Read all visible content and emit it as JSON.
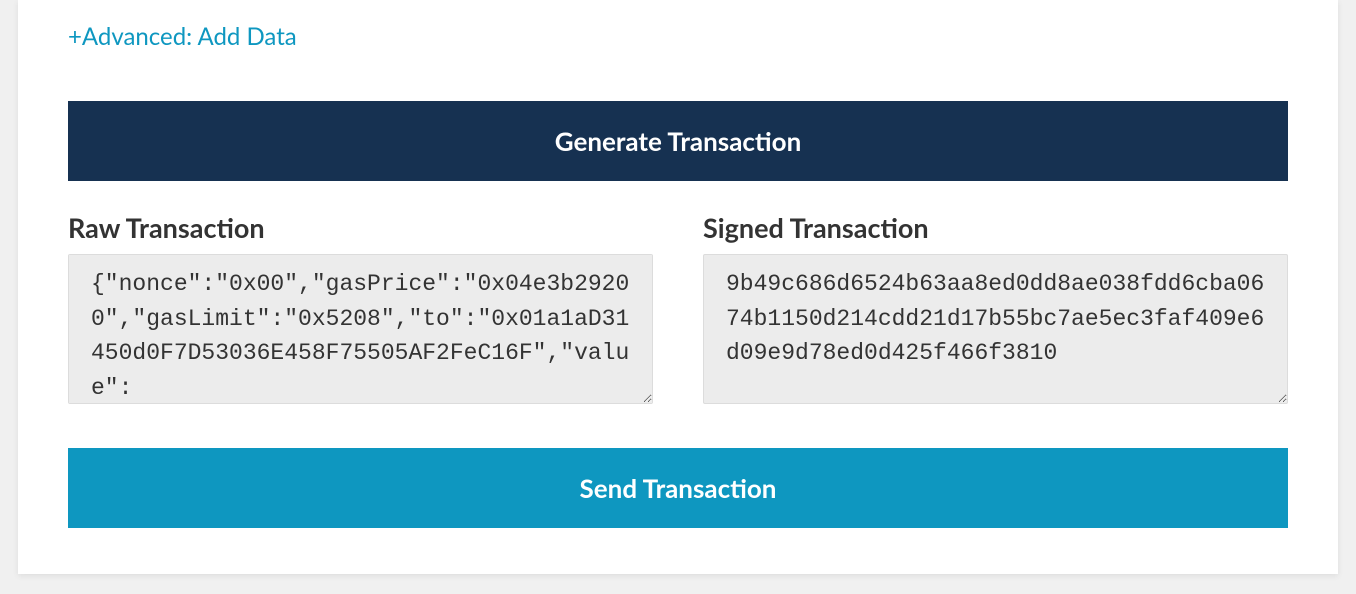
{
  "advanced_link": "+Advanced: Add Data",
  "buttons": {
    "generate": "Generate Transaction",
    "send": "Send Transaction"
  },
  "raw": {
    "label": "Raw Transaction",
    "value": "{\"nonce\":\"0x00\",\"gasPrice\":\"0x04e3b29200\",\"gasLimit\":\"0x5208\",\"to\":\"0x01a1aD31450d0F7D53036E458F75505AF2FeC16F\",\"value\":"
  },
  "signed": {
    "label": "Signed Transaction",
    "value": "9b49c686d6524b63aa8ed0dd8ae038fdd6cba0674b1150d214cdd21d17b55bc7ae5ec3faf409e6d09e9d78ed0d425f466f3810"
  }
}
